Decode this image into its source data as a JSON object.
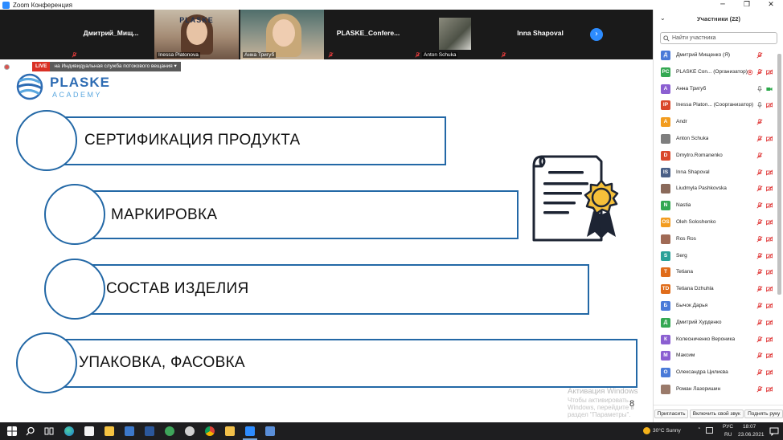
{
  "window": {
    "title": "Zoom Конференция",
    "controls": [
      "─",
      "❐",
      "✕"
    ]
  },
  "video_strip": {
    "tiles": [
      {
        "name": "Дмитрий_Мищ...",
        "label": "",
        "kind": "name-only"
      },
      {
        "name": "",
        "label": "Inessa Platonova",
        "kind": "video"
      },
      {
        "name": "",
        "label": "Анна Тригуб",
        "kind": "video"
      },
      {
        "name": "PLASKE_Confere...",
        "label": "",
        "kind": "name-only"
      },
      {
        "name": "",
        "label": "Anton Schuka",
        "kind": "photo"
      },
      {
        "name": "Inna Shapoval",
        "label": "",
        "kind": "name-only"
      }
    ],
    "video_a_wall_text": "PLASKE",
    "next_arrow": "›"
  },
  "slide": {
    "live_badge": "LIVE",
    "live_service": "на Индивидуальная служба потокового вещания ▾",
    "logo_main": "PLASKE",
    "logo_sub": "ACADEMY",
    "items": [
      "СЕРТИФИКАЦИЯ ПРОДУКТА",
      "МАРКИРОВКА",
      "СОСТАВ ИЗДЕЛИЯ",
      "УПАКОВКА, ФАСОВКА"
    ],
    "page_number": "8",
    "watermark_title": "Активация Windows",
    "watermark_sub": "Чтобы активировать Windows, перейдите в раздел \"Параметры\"."
  },
  "participants": {
    "header": "Участники (22)",
    "collapse_icon": "⌄",
    "search_placeholder": "Найти участника",
    "list": [
      {
        "initials": "Д",
        "color": "#4a7ad8",
        "name": "Дмитрий Мищенко (Я)",
        "video": false,
        "audio": "muted"
      },
      {
        "initials": "PC",
        "color": "#33a852",
        "name": "PLASKE Con... (Организатор)",
        "video": "off",
        "audio": "muted"
      },
      {
        "initials": "А",
        "color": "#8b5fd1",
        "name": "Анна Тригуб",
        "video": "on",
        "audio": "on"
      },
      {
        "initials": "IP",
        "color": "#d9472b",
        "name": "Inessa Platon... (Соорганизатор)",
        "video": "off",
        "audio": "on"
      },
      {
        "initials": "A",
        "color": "#f29c1f",
        "name": "Andr",
        "video": false,
        "audio": "muted"
      },
      {
        "initials": "",
        "color": "#7e7e7e",
        "name": "Anton Schuka",
        "video": "off",
        "audio": "muted"
      },
      {
        "initials": "D",
        "color": "#d9472b",
        "name": "Dmytro.Romanenko",
        "video": false,
        "audio": "muted"
      },
      {
        "initials": "IS",
        "color": "#4a5f86",
        "name": "Inna Shapoval",
        "video": "off",
        "audio": "muted"
      },
      {
        "initials": "",
        "color": "#8a6a5a",
        "name": "Liudmyla Pashkovska",
        "video": "off",
        "audio": "muted"
      },
      {
        "initials": "N",
        "color": "#33a852",
        "name": "Nastia",
        "video": "off",
        "audio": "muted"
      },
      {
        "initials": "OS",
        "color": "#f29c1f",
        "name": "Oleh Soloshenko",
        "video": "off",
        "audio": "muted"
      },
      {
        "initials": "",
        "color": "#a06a55",
        "name": "Ros Ros",
        "video": "off",
        "audio": "muted"
      },
      {
        "initials": "S",
        "color": "#2aa198",
        "name": "Serg",
        "video": "off",
        "audio": "muted"
      },
      {
        "initials": "T",
        "color": "#e06c1a",
        "name": "Tetiana",
        "video": "off",
        "audio": "muted"
      },
      {
        "initials": "TD",
        "color": "#e06c1a",
        "name": "Tetiana Dzhuhla",
        "video": "off",
        "audio": "muted"
      },
      {
        "initials": "Б",
        "color": "#4a7ad8",
        "name": "Бычок Дарья",
        "video": "off",
        "audio": "muted"
      },
      {
        "initials": "Д",
        "color": "#33a852",
        "name": "Дмитрий Хурденко",
        "video": "off",
        "audio": "muted"
      },
      {
        "initials": "К",
        "color": "#8b5fd1",
        "name": "Колесниченко Вероника",
        "video": "off",
        "audio": "muted"
      },
      {
        "initials": "М",
        "color": "#8b5fd1",
        "name": "Максим",
        "video": "off",
        "audio": "muted"
      },
      {
        "initials": "О",
        "color": "#4a7ad8",
        "name": "Олександра Цилиєва",
        "video": "off",
        "audio": "muted"
      },
      {
        "initials": "",
        "color": "#9a7a6a",
        "name": "Роман Лазоришин",
        "video": "off",
        "audio": "muted"
      }
    ],
    "footer": {
      "invite": "Пригласить",
      "unmute": "Включить свой звук",
      "raise_hand": "Поднять руку"
    }
  },
  "taskbar": {
    "weather": "30°C  Sunny",
    "lang": "РУС",
    "lang_sub": "RU",
    "time": "18:07",
    "date": "23.06.2021",
    "icons": [
      "windows-start",
      "search",
      "task-view",
      "edge",
      "store",
      "explorer",
      "word",
      "onlyoffice",
      "settings",
      "chrome",
      "files",
      "zoom",
      "calculator"
    ]
  },
  "colors": {
    "accent": "#2368a6",
    "zoom_blue": "#2d8cff",
    "mute_red": "#e03b3b",
    "live_red": "#d93025"
  }
}
